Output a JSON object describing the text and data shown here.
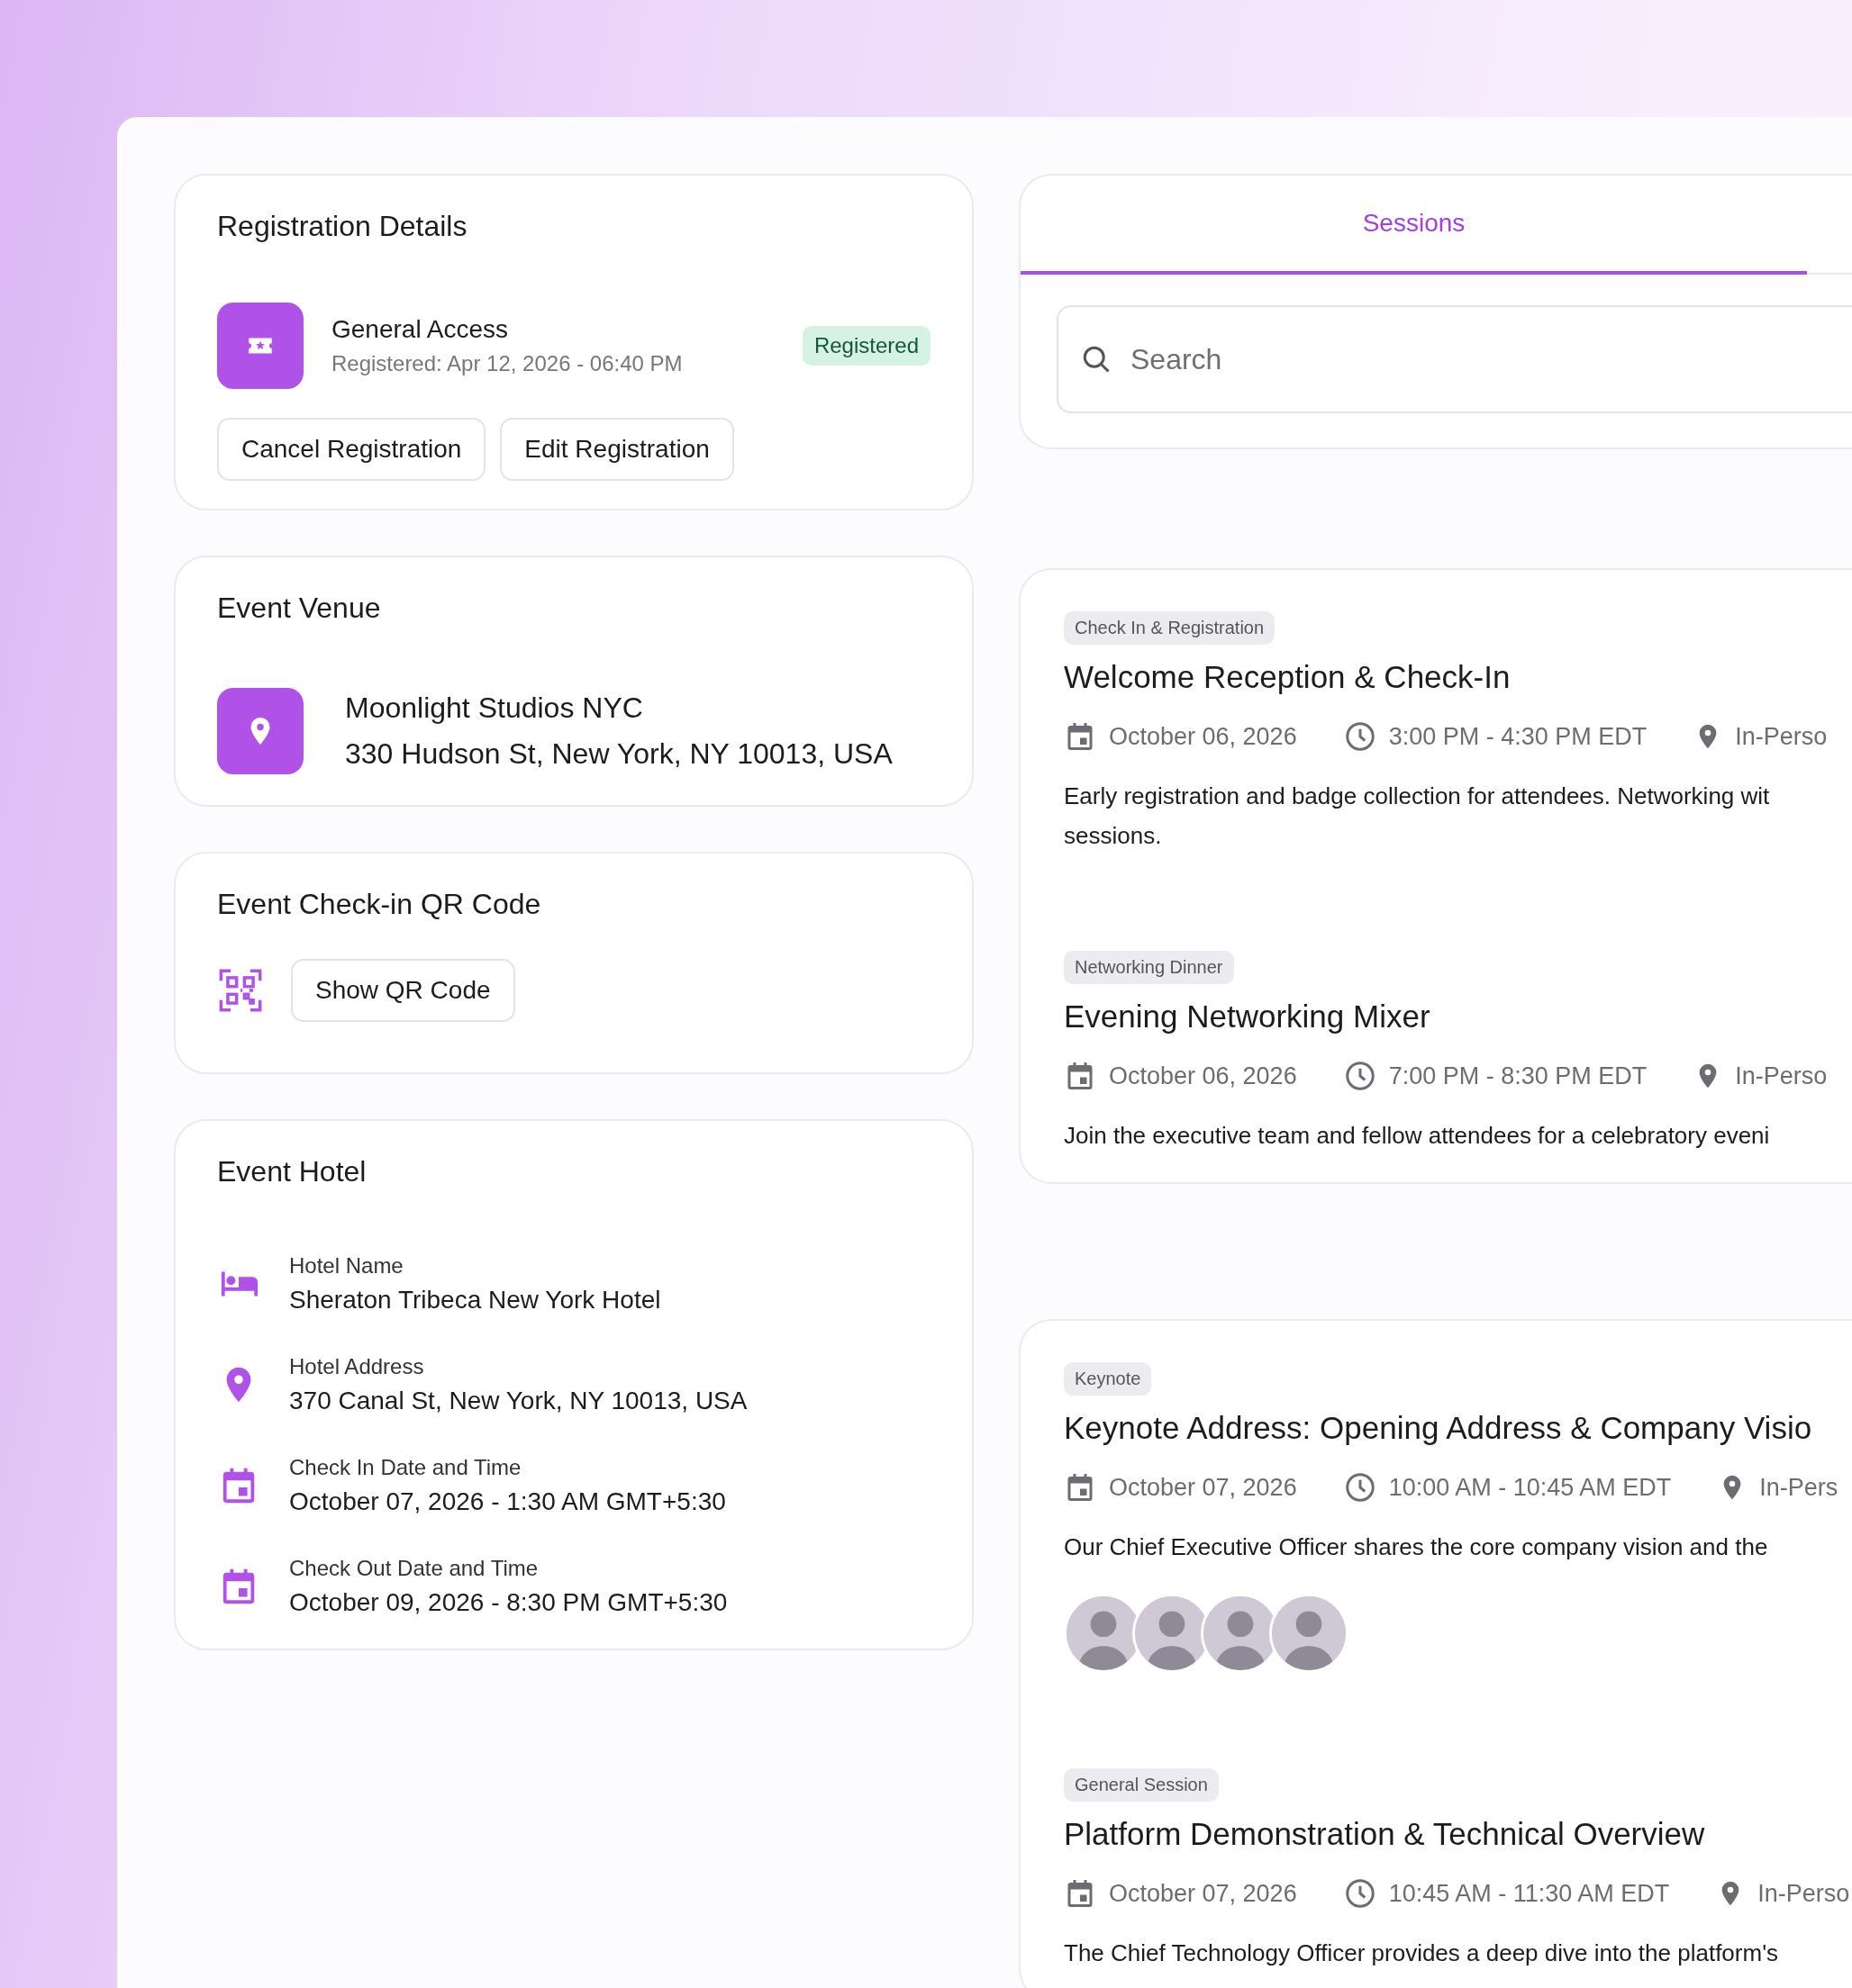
{
  "registration": {
    "title": "Registration Details",
    "ticket_name": "General Access",
    "registered_on": "Registered: Apr 12, 2026 - 06:40 PM",
    "status": "Registered",
    "buttons": [
      "Cancel Registration",
      "Edit Registration"
    ]
  },
  "venue": {
    "title": "Event Venue",
    "name": "Moonlight Studios NYC",
    "address": "330 Hudson St, New York, NY 10013, USA"
  },
  "qr": {
    "title": "Event Check-in QR Code",
    "button": "Show QR Code"
  },
  "hotel": {
    "title": "Event Hotel",
    "fields": [
      {
        "kind": "bed",
        "label": "Hotel Name",
        "value": "Sheraton Tribeca New York Hotel"
      },
      {
        "kind": "pin",
        "label": "Hotel Address",
        "value": "370 Canal St, New York, NY 10013, USA"
      },
      {
        "kind": "calendar",
        "label": "Check In Date and Time",
        "value": "October 07, 2026 - 1:30 AM GMT+5:30"
      },
      {
        "kind": "calendar",
        "label": "Check Out Date and Time",
        "value": "October 09, 2026 - 8:30 PM GMT+5:30"
      }
    ]
  },
  "tabs": [
    {
      "label": "Sessions",
      "selected": true
    }
  ],
  "search": {
    "placeholder": "Search"
  },
  "session_groups": [
    {
      "sessions": [
        {
          "tag": "Check In & Registration",
          "title": "Welcome Reception & Check-In",
          "date": "October 06, 2026",
          "time": "3:00 PM - 4:30 PM EDT",
          "location": "In-Perso",
          "description": "Early registration and badge collection for attendees. Networking wit\nsessions."
        },
        {
          "tag": "Networking Dinner",
          "title": "Evening Networking Mixer",
          "date": "October 06, 2026",
          "time": "7:00 PM - 8:30 PM EDT",
          "location": "In-Perso",
          "description": "Join the executive team and fellow attendees for a celebratory eveni"
        }
      ]
    },
    {
      "sessions": [
        {
          "tag": "Keynote",
          "title": "Keynote Address: Opening Address & Company Visio",
          "date": "October 07, 2026",
          "time": "10:00 AM - 10:45 AM EDT",
          "location": "In-Pers",
          "description": "Our Chief Executive Officer shares the core company vision and the",
          "speakers": [
            {
              "kind": "photo"
            },
            {
              "kind": "photo"
            },
            {
              "kind": "photo"
            },
            {
              "kind": "photo"
            }
          ]
        },
        {
          "tag": "General Session",
          "title": "Platform Demonstration & Technical Overview",
          "date": "October 07, 2026",
          "time": "10:45 AM - 11:30 AM EDT",
          "location": "In-Perso",
          "description": "The Chief Technology Officer provides a deep dive into the platform's"
        }
      ]
    }
  ]
}
